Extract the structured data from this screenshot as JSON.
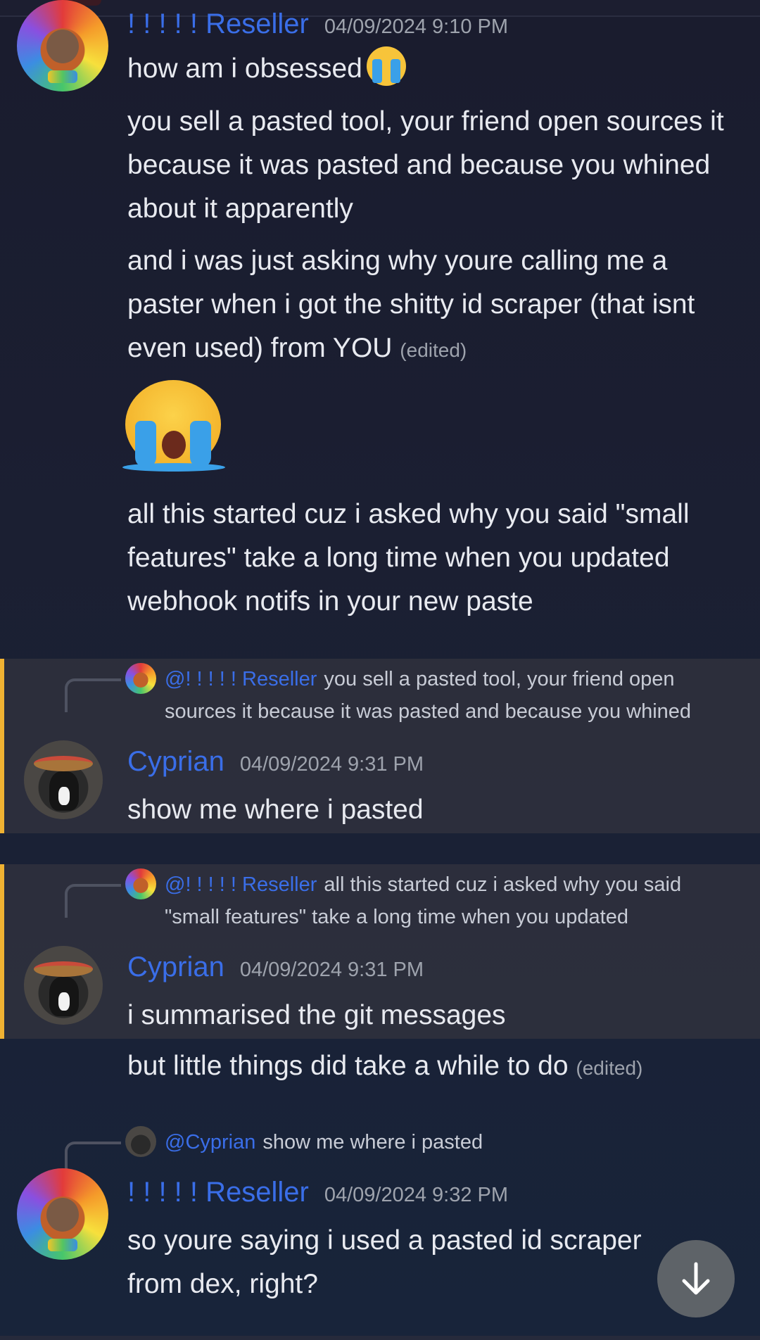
{
  "messages": {
    "m1": {
      "author": "! ! ! ! ! Reseller",
      "timestamp": "04/09/2024 9:10 PM",
      "line1": "how am i obsessed",
      "para2": "you sell a pasted tool, your friend open sources it because it was pasted and because you whined about it apparently",
      "para3": "and i was just asking why youre calling me a paster when i got the shitty id scraper (that isnt even used) from YOU",
      "para3_edited": "(edited)",
      "para4": "all this started cuz i asked why you said \"small features\" take a long time when you updated webhook notifs in your new paste"
    },
    "m2": {
      "reply_mention": "@! ! ! ! ! Reseller",
      "reply_text": "you sell a pasted tool, your friend open sources it because it was pasted and because you whined",
      "author": "Cyprian",
      "timestamp": "04/09/2024 9:31 PM",
      "text": "show me where i pasted"
    },
    "m3": {
      "reply_mention": "@! ! ! ! ! Reseller",
      "reply_text": "all this started cuz i asked why you said \"small features\" take a long time when you updated",
      "author": "Cyprian",
      "timestamp": "04/09/2024 9:31 PM",
      "text": "i summarised the git messages",
      "text2": "but little things did take a while to do",
      "text2_edited": "(edited)"
    },
    "m4": {
      "reply_mention": "@Cyprian",
      "reply_text": "show me where i pasted",
      "author": "! ! ! ! ! Reseller",
      "timestamp": "04/09/2024 9:32 PM",
      "text": "so youre saying i used a pasted id scraper from dex, right?"
    }
  },
  "icons": {
    "scroll_down": "arrow-down-icon",
    "crying_emoji": "loudly-crying-face-emoji"
  },
  "colors": {
    "username": "#3a6ee8",
    "reply_highlight": "#f0b232"
  }
}
